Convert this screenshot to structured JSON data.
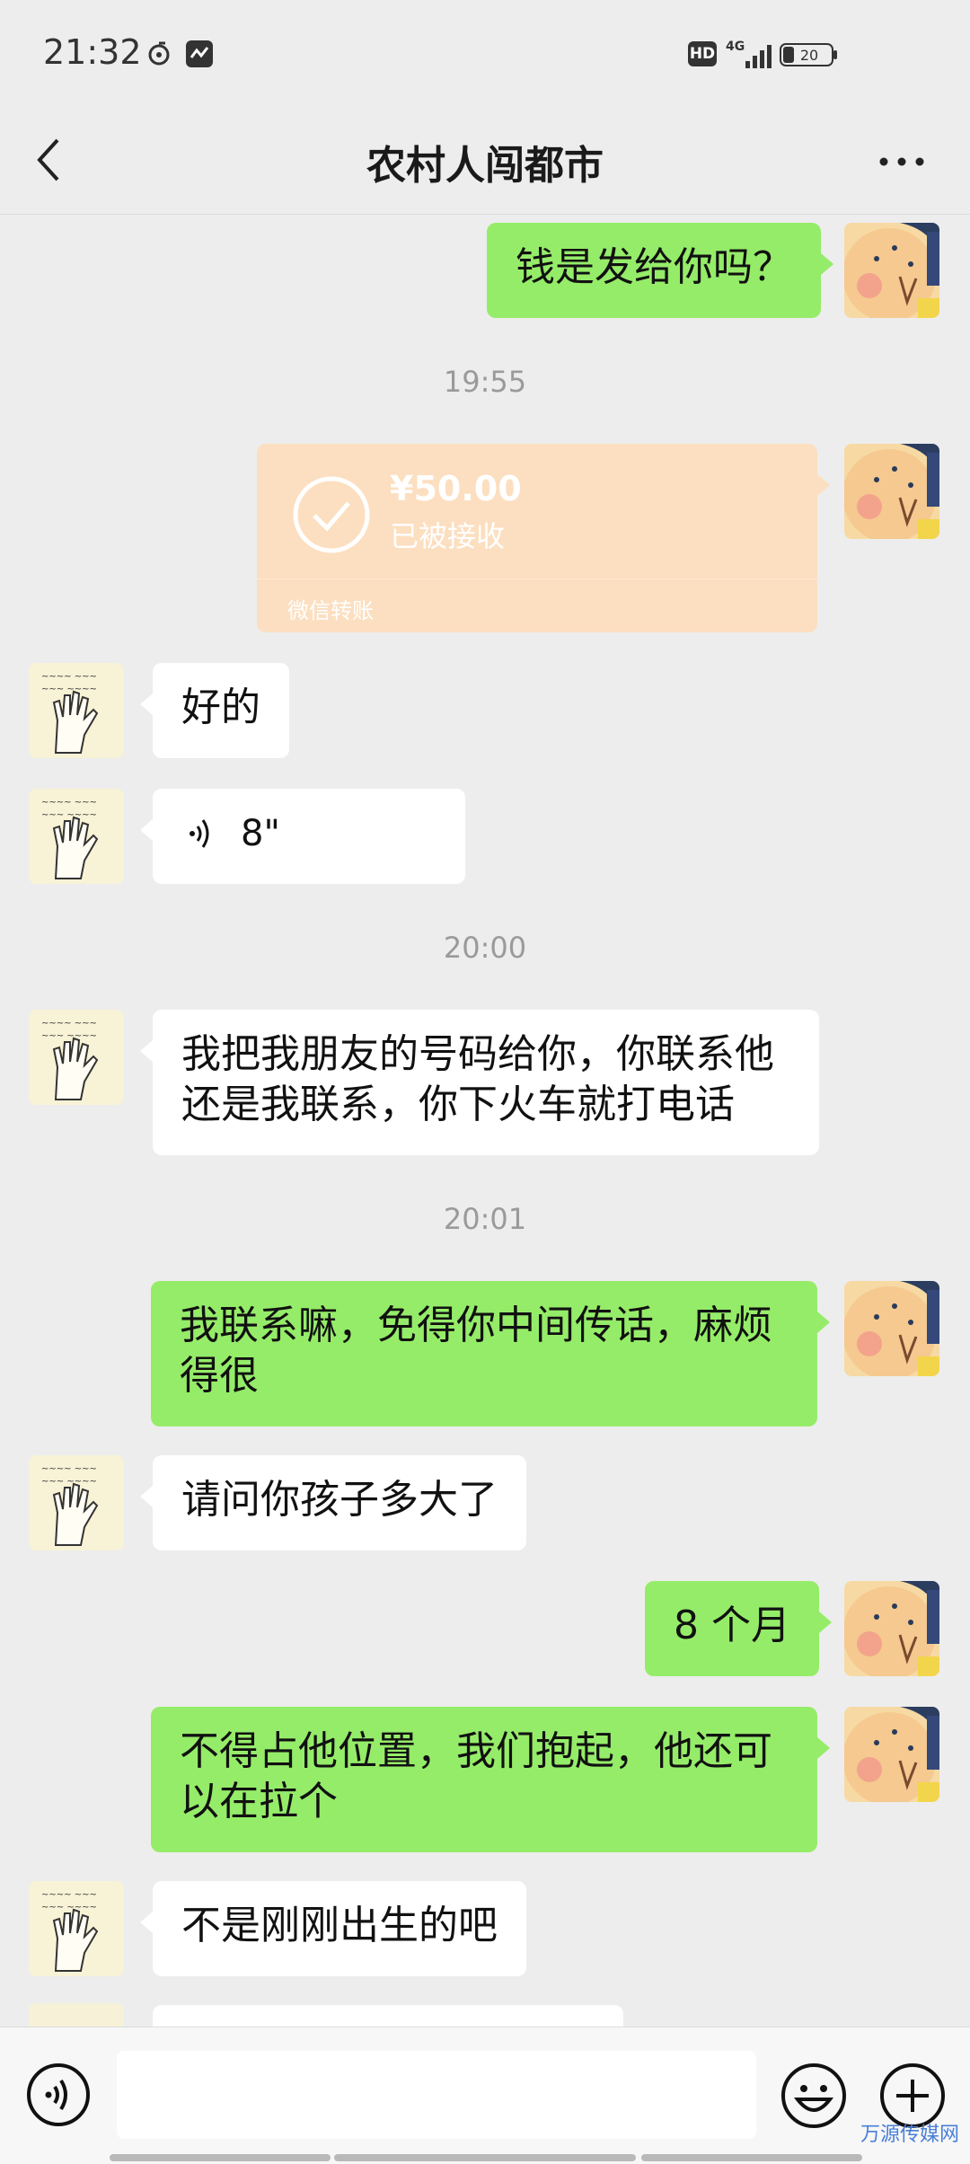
{
  "status_bar": {
    "time": "21:32",
    "hd": "HD",
    "network": "4G",
    "battery": "20"
  },
  "nav": {
    "title": "农村人闯都市"
  },
  "messages": [
    {
      "text": "钱是发给你吗？"
    },
    {
      "timestamp": "19:55"
    },
    {
      "transfer_amount": "¥50.00",
      "transfer_status": "已被接收",
      "transfer_source": "微信转账"
    },
    {
      "text": "好的"
    },
    {
      "voice_duration": "8\""
    },
    {
      "timestamp": "20:00"
    },
    {
      "text": "我把我朋友的号码给你，你联系他还是我联系，你下火车就打电话"
    },
    {
      "timestamp": "20:01"
    },
    {
      "text": "我联系嘛，免得你中间传话，麻烦得很"
    },
    {
      "text": "请问你孩子多大了"
    },
    {
      "text": "8 个月"
    },
    {
      "text": "不得占他位置，我们抱起，他还可以在拉个"
    },
    {
      "text": "不是刚刚出生的吧"
    }
  ],
  "watermark": "万源传媒网",
  "colors": {
    "outgoing_bubble": "#95ec69",
    "incoming_bubble": "#ffffff",
    "transfer_card": "#fcdfc0",
    "background": "#ededed"
  }
}
